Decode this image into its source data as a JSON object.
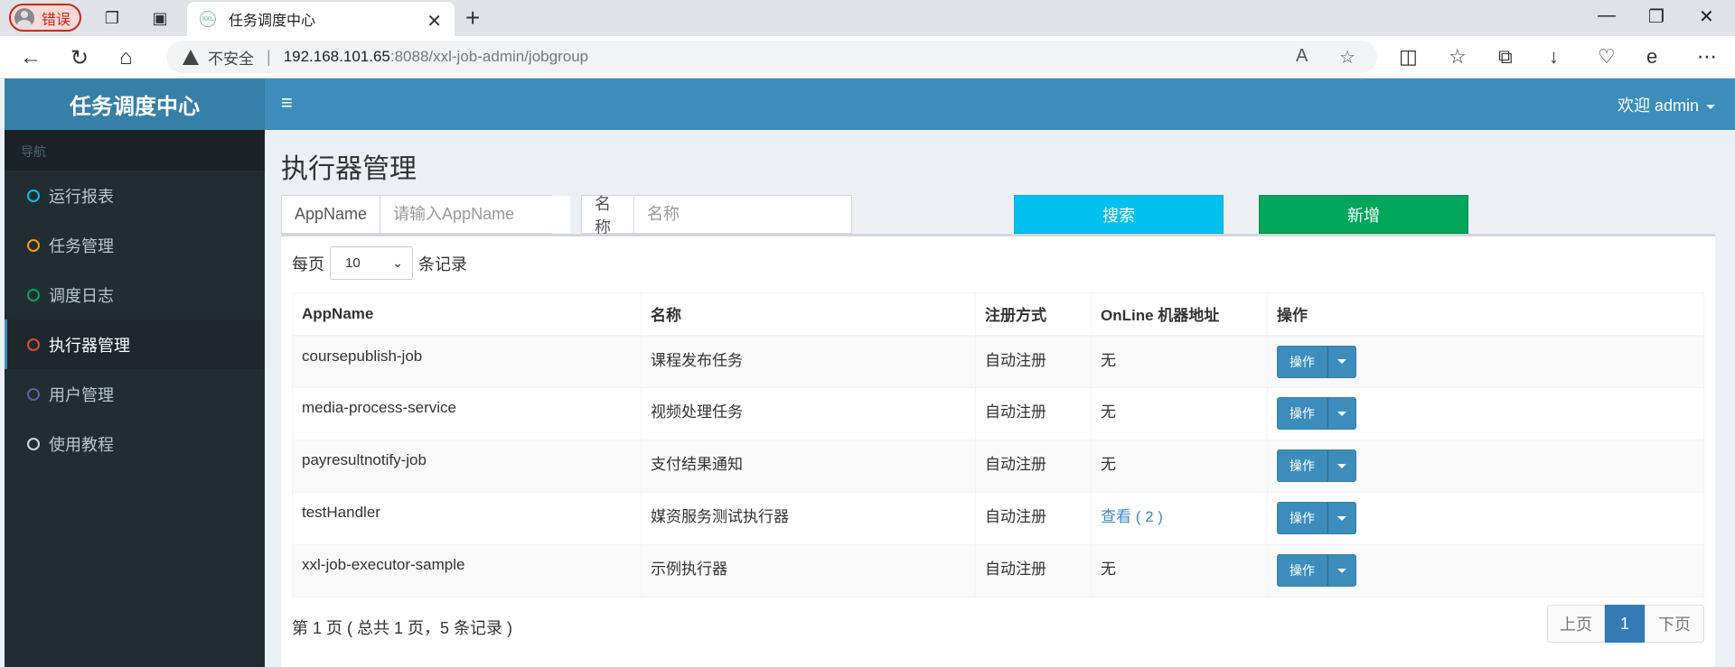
{
  "browser": {
    "profile_label": "错误",
    "tab_title": "任务调度中心",
    "tab_favicon": "XXL",
    "address": {
      "security_label": "不安全",
      "separator": "|",
      "host": "192.168.101.65",
      "path": ":8088/xxl-job-admin/jobgroup"
    }
  },
  "app": {
    "logo": "任务调度中心",
    "user_menu": "欢迎 admin",
    "sidebar": {
      "header": "导航",
      "items": [
        {
          "label": "运行报表",
          "color": "#00c0ef"
        },
        {
          "label": "任务管理",
          "color": "#f39c12"
        },
        {
          "label": "调度日志",
          "color": "#00a65a"
        },
        {
          "label": "执行器管理",
          "color": "#dd4b39"
        },
        {
          "label": "用户管理",
          "color": "#605ca8"
        },
        {
          "label": "使用教程",
          "color": "#d2d6de"
        }
      ],
      "active": "执行器管理"
    },
    "page_title": "执行器管理",
    "filters": {
      "appname_label": "AppName",
      "appname_placeholder": "请输入AppName",
      "name_label": "名称",
      "name_placeholder": "名称",
      "search_button": "搜索",
      "add_button": "新增"
    },
    "length_menu": {
      "prefix": "每页",
      "value": "10",
      "suffix": "条记录"
    },
    "table": {
      "columns": [
        "AppName",
        "名称",
        "注册方式",
        "OnLine 机器地址",
        "操作"
      ],
      "rows": [
        {
          "appname": "coursepublish-job",
          "name": "课程发布任务",
          "reg": "自动注册",
          "online": "无",
          "op": "操作"
        },
        {
          "appname": "media-process-service",
          "name": "视频处理任务",
          "reg": "自动注册",
          "online": "无",
          "op": "操作"
        },
        {
          "appname": "payresultnotify-job",
          "name": "支付结果通知",
          "reg": "自动注册",
          "online": "无",
          "op": "操作"
        },
        {
          "appname": "testHandler",
          "name": "媒资服务测试执行器",
          "reg": "自动注册",
          "online": "查看 ( 2 )",
          "op": "操作"
        },
        {
          "appname": "xxl-job-executor-sample",
          "name": "示例执行器",
          "reg": "自动注册",
          "online": "无",
          "op": "操作"
        }
      ]
    },
    "info": "第 1 页 ( 总共 1 页，5 条记录 )",
    "pager": {
      "prev": "上页",
      "current": "1",
      "next": "下页"
    }
  }
}
